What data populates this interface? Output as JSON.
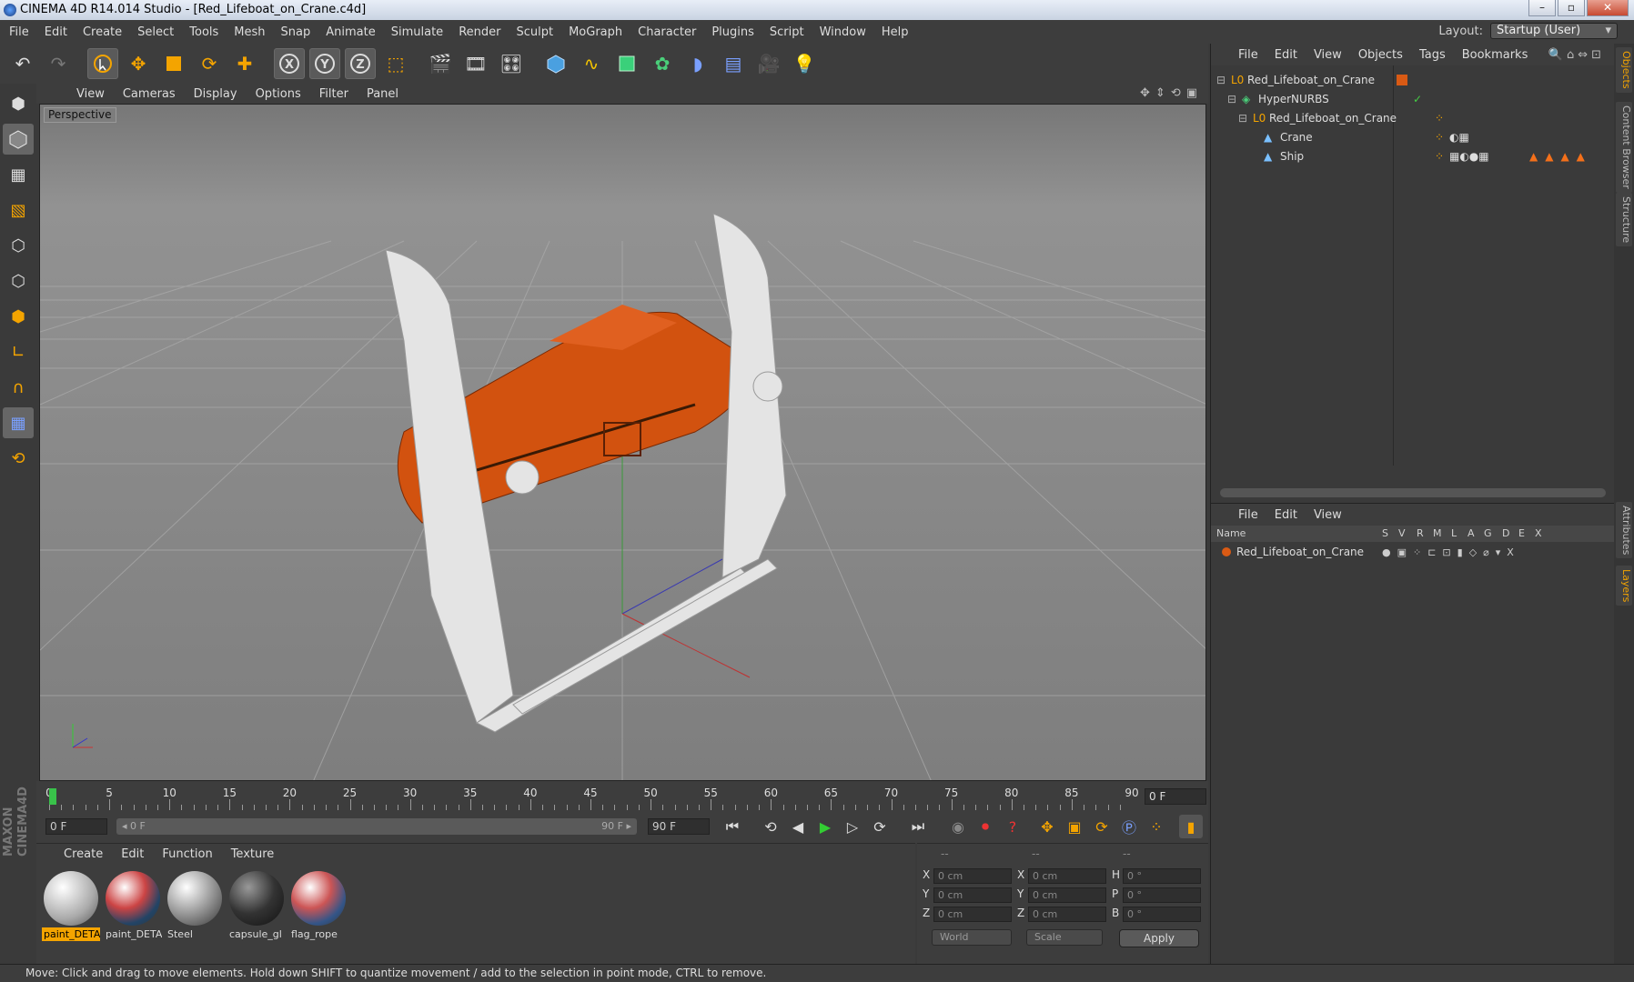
{
  "window": {
    "title": "CINEMA 4D R14.014 Studio - [Red_Lifeboat_on_Crane.c4d]"
  },
  "menubar": [
    "File",
    "Edit",
    "Create",
    "Select",
    "Tools",
    "Mesh",
    "Snap",
    "Animate",
    "Simulate",
    "Render",
    "Sculpt",
    "MoGraph",
    "Character",
    "Plugins",
    "Script",
    "Window",
    "Help"
  ],
  "layout": {
    "label": "Layout:",
    "value": "Startup (User)"
  },
  "viewport": {
    "menu": [
      "View",
      "Cameras",
      "Display",
      "Options",
      "Filter",
      "Panel"
    ],
    "label": "Perspective"
  },
  "timeline": {
    "ticks": [
      "0",
      "5",
      "10",
      "15",
      "20",
      "25",
      "30",
      "35",
      "40",
      "45",
      "50",
      "55",
      "60",
      "65",
      "70",
      "75",
      "80",
      "85",
      "90"
    ],
    "end_frame": "0 F",
    "current": "0 F",
    "range_start": "◂ 0 F",
    "range_end": "90 F ▸",
    "max": "90 F"
  },
  "materials": {
    "menu": [
      "Create",
      "Edit",
      "Function",
      "Texture"
    ],
    "items": [
      {
        "name": "paint_DETA",
        "selected": true
      },
      {
        "name": "paint_DETA",
        "selected": false
      },
      {
        "name": "Steel",
        "selected": false
      },
      {
        "name": "capsule_gl",
        "selected": false
      },
      {
        "name": "flag_rope",
        "selected": false
      }
    ]
  },
  "coords": {
    "header": [
      "--",
      "--",
      "--"
    ],
    "rows": [
      {
        "a": "X",
        "av": "0 cm",
        "b": "X",
        "bv": "0 cm",
        "c": "H",
        "cv": "0 °"
      },
      {
        "a": "Y",
        "av": "0 cm",
        "b": "Y",
        "bv": "0 cm",
        "c": "P",
        "cv": "0 °"
      },
      {
        "a": "Z",
        "av": "0 cm",
        "b": "Z",
        "bv": "0 cm",
        "c": "B",
        "cv": "0 °"
      }
    ],
    "mode": "World",
    "type": "Scale",
    "apply": "Apply"
  },
  "objects": {
    "menu": [
      "File",
      "Edit",
      "View",
      "Objects",
      "Tags",
      "Bookmarks"
    ],
    "rows": [
      {
        "name": "Red_Lifeboat_on_Crane"
      },
      {
        "name": "HyperNURBS"
      },
      {
        "name": "Red_Lifeboat_on_Crane"
      },
      {
        "name": "Crane"
      },
      {
        "name": "Ship"
      }
    ]
  },
  "layers": {
    "menu": [
      "File",
      "Edit",
      "View"
    ],
    "head_name": "Name",
    "columns": [
      "S",
      "V",
      "R",
      "M",
      "L",
      "A",
      "G",
      "D",
      "E",
      "X"
    ],
    "rows": [
      {
        "name": "Red_Lifeboat_on_Crane"
      }
    ]
  },
  "sidetabs": [
    "Objects",
    "Content Browser",
    "Structure",
    "Attributes",
    "Layers"
  ],
  "status": "Move: Click and drag to move elements. Hold down SHIFT to quantize movement / add to the selection in point mode, CTRL to remove.",
  "colors": {
    "accent": "#f4a400",
    "orange": "#d95a14"
  }
}
